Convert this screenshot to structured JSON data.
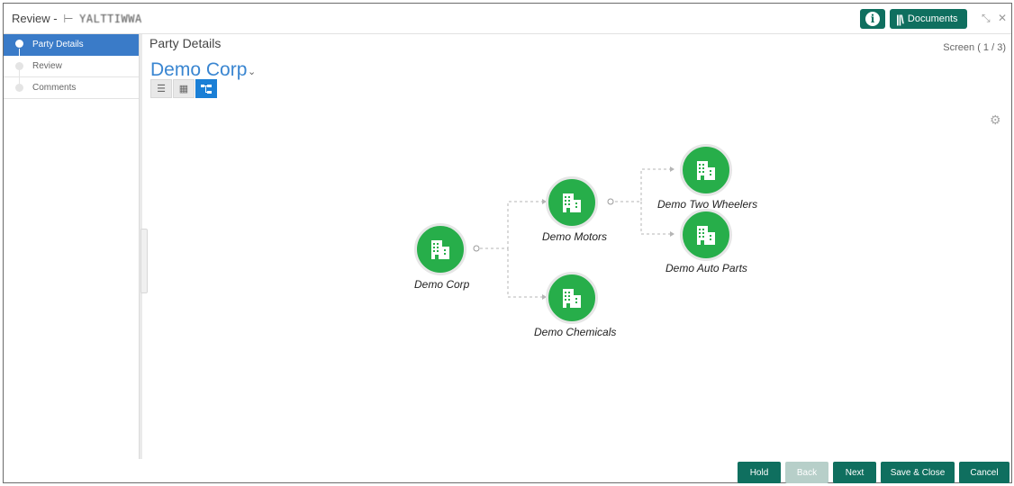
{
  "header": {
    "title": "Review -",
    "separator": "",
    "reference": "YALTTIWWA",
    "documents_label": "Documents",
    "info_icon": "info-icon",
    "minimize_glyph": "↙↗",
    "close_glyph": "✕"
  },
  "sidebar": {
    "items": [
      {
        "label": "Party Details",
        "active": true
      },
      {
        "label": "Review",
        "active": false
      },
      {
        "label": "Comments",
        "active": false
      }
    ]
  },
  "main": {
    "title": "Party Details",
    "screen_indicator": "Screen ( 1 / 3)",
    "party_name": "Demo Corp",
    "view_modes": [
      {
        "icon": "list-view-icon",
        "active": false
      },
      {
        "icon": "grid-view-icon",
        "active": false
      },
      {
        "icon": "tree-view-icon",
        "active": true
      }
    ]
  },
  "tree": {
    "nodes": [
      {
        "id": "demo-corp",
        "label": "Demo Corp"
      },
      {
        "id": "demo-motors",
        "label": "Demo Motors"
      },
      {
        "id": "demo-chemicals",
        "label": "Demo Chemicals"
      },
      {
        "id": "demo-two-wheelers",
        "label": "Demo Two Wheelers"
      },
      {
        "id": "demo-auto-parts",
        "label": "Demo Auto Parts"
      }
    ],
    "node_color": "#27ae4a",
    "node_icon": "building-icon"
  },
  "footer": {
    "hold": "Hold",
    "back": "Back",
    "next": "Next",
    "save_close": "Save & Close",
    "cancel": "Cancel"
  },
  "colors": {
    "primary_button": "#0f6f5f",
    "sidebar_active": "#3a7bc8",
    "party_name": "#3a86d1"
  }
}
